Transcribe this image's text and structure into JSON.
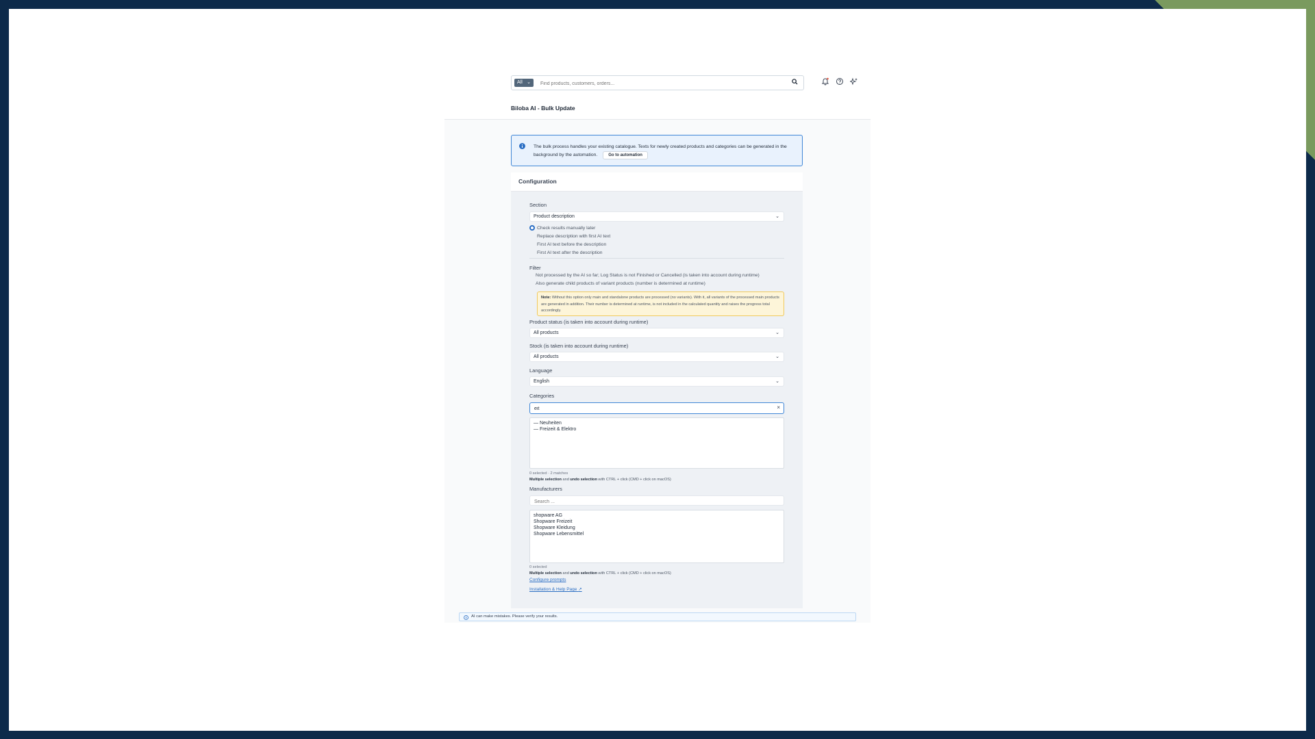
{
  "colors": {
    "frame": "#0d2a4a",
    "accent_green": "#7a9a5e",
    "brand_blue": "#2c6fc4",
    "warning_bg": "#fdf5d9"
  },
  "header": {
    "search_scope": "All",
    "search_placeholder": "Find products, customers, orders...",
    "icons": [
      "bell-icon",
      "help-circle-icon",
      "sparkles-icon"
    ]
  },
  "page": {
    "title": "Biloba AI - Bulk Update"
  },
  "info_banner": {
    "text": "The bulk process handles your existing catalogue. Texts for newly created products and categories can be generated in the background by the automation.",
    "button_label": "Go to automation"
  },
  "config": {
    "title": "Configuration",
    "section_label": "Section",
    "section_value": "Product description",
    "modes": [
      {
        "label": "Check results manually later",
        "selected": true
      },
      {
        "label": "Replace description with first AI text",
        "selected": false
      },
      {
        "label": "First AI text before the description",
        "selected": false
      },
      {
        "label": "First AI text after the description",
        "selected": false
      }
    ],
    "filter_label": "Filter",
    "filters": [
      {
        "label": "Not processed by the AI so far; Log Status is not Finished or Cancelled (is taken into account during runtime)"
      },
      {
        "label": "Also generate child products of variant products (number is determined at runtime)"
      }
    ],
    "note_prefix": "Note:",
    "note_text": "Without this option only main and standalone products are processed (no variants). With it, all variants of the processed main products are generated in addition. Their number is determined at runtime, is not included in the calculated quantity and raises the progress total accordingly.",
    "product_status_label": "Product status (is taken into account during runtime)",
    "product_status_value": "All products",
    "stock_label": "Stock (is taken into account during runtime)",
    "stock_value": "All products",
    "language_label": "Language",
    "language_value": "English",
    "categories_label": "Categories",
    "categories_search": "eit",
    "categories_options": [
      "— Neuheiten",
      "— Freizeit & Elektro"
    ],
    "categories_meta": "0 selected · 2 matches",
    "multi_help_1": "Multiple selection",
    "multi_help_2": " and ",
    "multi_help_3": "undo selection",
    "multi_help_4": " with CTRL + click (CMD + click on macOS)",
    "manufacturers_label": "Manufacturers",
    "manufacturers_placeholder": "Search ...",
    "manufacturers_options": [
      "shopware AG",
      "Shopware Freizeit",
      "Shopware Kleidung",
      "Shopware Lebensmittel"
    ],
    "manufacturers_meta": "0 selected",
    "configure_prompts_link": "Configure prompts",
    "help_link": "Installation & Help Page"
  },
  "footer": {
    "disclaimer": "AI can make mistakes. Please verify your results."
  }
}
